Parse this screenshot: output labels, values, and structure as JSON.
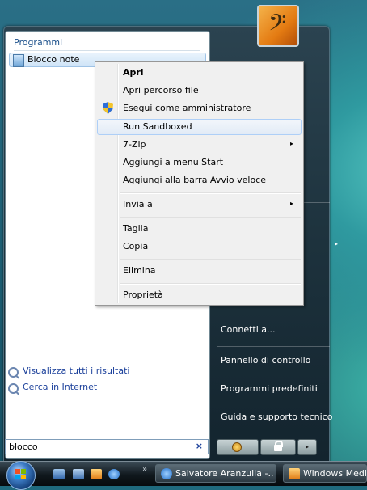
{
  "start_menu": {
    "programs_header": "Programmi",
    "program_item": "Blocco note",
    "search_links": [
      "Visualizza tutti i risultati",
      "Cerca in Internet"
    ],
    "search_value": "blocco",
    "search_clear": "×",
    "right_items": [
      "Connetti a...",
      "Pannello di controllo",
      "Programmi predefiniti",
      "Guida e supporto tecnico"
    ],
    "submenu_arrow": "▸",
    "user_picture_icon": "bass-clef-icon"
  },
  "context_menu": {
    "items": [
      {
        "label": "Apri",
        "bold": true
      },
      {
        "label": "Apri percorso file"
      },
      {
        "label": "Esegui come amministratore",
        "icon": "uac-shield-icon"
      },
      {
        "label": "Run Sandboxed",
        "highlighted": true
      },
      {
        "label": "7-Zip",
        "submenu": "▸"
      },
      {
        "label": "Aggiungi a menu Start"
      },
      {
        "label": "Aggiungi alla barra Avvio veloce"
      },
      {
        "label": "Invia a",
        "submenu": "▸"
      },
      {
        "label": "Taglia"
      },
      {
        "label": "Copia"
      },
      {
        "label": "Elimina"
      },
      {
        "label": "Proprietà"
      }
    ]
  },
  "taskbar": {
    "start_orb_icon": "windows-orb-icon",
    "quicklaunch_more": "»",
    "tasks": [
      {
        "label": "Salvatore Aranzulla -...",
        "icon": "internet-explorer-icon"
      },
      {
        "label": "Windows Media",
        "icon": "windows-media-player-icon"
      }
    ]
  },
  "colors": {
    "link_blue": "#1a3f9a",
    "menu_highlight": "#aecff7",
    "uac_blue": "#2e6ed8",
    "uac_yellow": "#f3c42c"
  }
}
